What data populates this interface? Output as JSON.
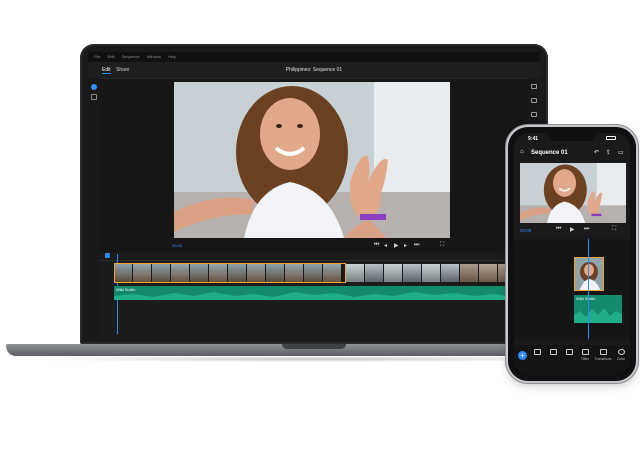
{
  "laptop": {
    "menu": [
      "File",
      "Edit",
      "Sequence",
      "Window",
      "Help"
    ],
    "tabs": [
      "Edit",
      "Share"
    ],
    "sequence_title": "Philippines: Sequence 01",
    "timecode": "00:00",
    "audio_clip": "Wild Surfin"
  },
  "phone": {
    "time": "9:41",
    "sequence_title": "Sequence 01",
    "timecode": "00:00",
    "audio_clip": "Wild Surfin",
    "toolbar": [
      "Titles",
      "Transitions",
      "Color"
    ],
    "add_label": "+"
  },
  "colors": {
    "accent": "#2d8cff",
    "clip_select": "#f2a135",
    "audio": "#138a6c",
    "ui_dark": "#1b1b1c"
  },
  "icons": {
    "add": "plus-icon",
    "play": "play-icon",
    "home": "home-icon",
    "share": "share-icon"
  }
}
